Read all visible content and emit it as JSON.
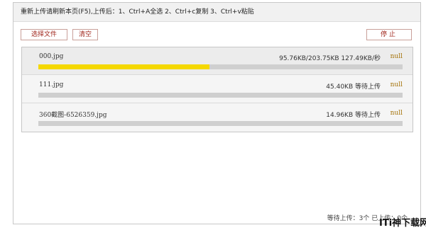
{
  "header": {
    "instruction": "重新上传请刷新本页(F5),上传后：1、Ctrl+A全选 2、Ctrl+c复制 3、Ctrl+v粘贴"
  },
  "toolbar": {
    "select_label": "选择文件",
    "clear_label": "清空",
    "stop_label": "停止"
  },
  "files": [
    {
      "name": "000.jpg",
      "status": "95.76KB/203.75KB 127.49KB/秒",
      "result": "null",
      "progress_percent": 47
    },
    {
      "name": "111.jpg",
      "status": "45.40KB  等待上传",
      "result": "null",
      "progress_percent": 0
    },
    {
      "name": "360截图-6526359.jpg",
      "status": "14.96KB  等待上传",
      "result": "null",
      "progress_percent": 0
    }
  ],
  "footer": {
    "summary": "等待上传：3个  已上传：0个"
  },
  "watermark": {
    "text": "ITi神下载网"
  },
  "colors": {
    "progress_fill": "#f5d800",
    "button_text": "#a0271d",
    "null_text": "#a47208"
  }
}
